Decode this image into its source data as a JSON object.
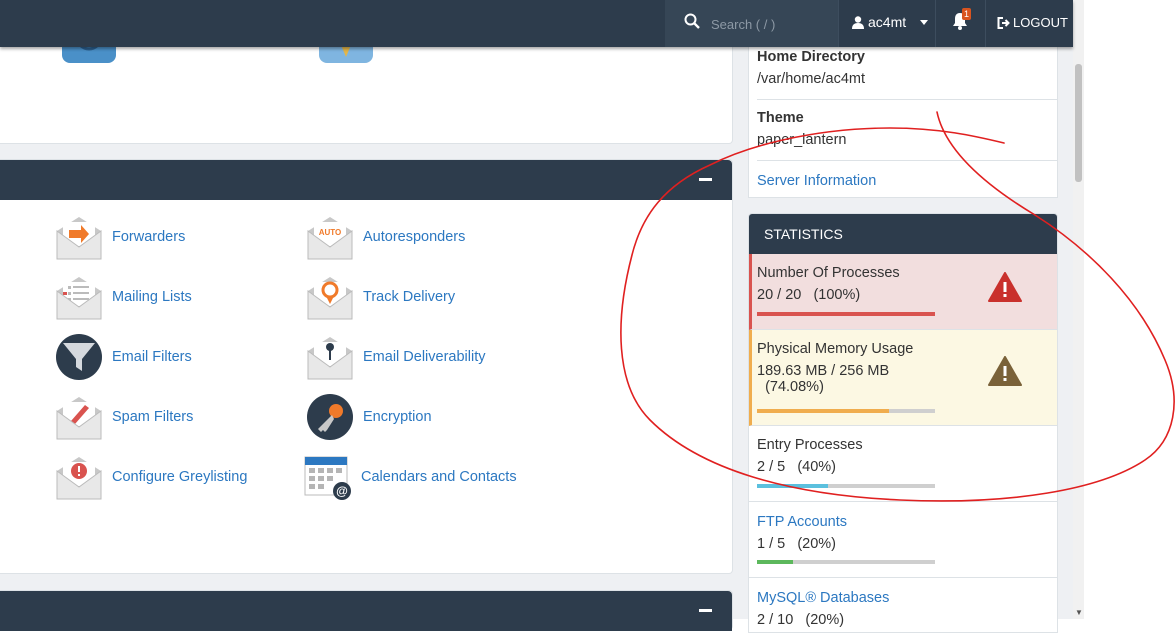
{
  "topbar": {
    "search_placeholder": "Search ( / )",
    "username": "ac4mt",
    "notification_count": "1",
    "logout_label": "LOGOUT"
  },
  "email_section": {
    "left_items": [
      {
        "label": "Forwarders",
        "icon": "forwarders-icon"
      },
      {
        "label": "Mailing Lists",
        "icon": "mailing-lists-icon"
      },
      {
        "label": "Email Filters",
        "icon": "email-filters-icon"
      },
      {
        "label": "Spam Filters",
        "icon": "spam-filters-icon"
      },
      {
        "label": "Configure Greylisting",
        "icon": "greylisting-icon"
      }
    ],
    "right_items": [
      {
        "label": "Autoresponders",
        "icon": "autoresponders-icon",
        "icon_text": "AUTO"
      },
      {
        "label": "Track Delivery",
        "icon": "track-delivery-icon"
      },
      {
        "label": "Email Deliverability",
        "icon": "email-deliverability-icon"
      },
      {
        "label": "Encryption",
        "icon": "encryption-icon"
      },
      {
        "label": "Calendars and Contacts",
        "icon": "calendars-contacts-icon"
      }
    ]
  },
  "general_info": {
    "home_directory_label": "Home Directory",
    "home_directory_value": "/var/home/ac4mt",
    "theme_label": "Theme",
    "theme_value": "paper_lantern",
    "server_info_link": "Server Information"
  },
  "statistics": {
    "title": "STATISTICS",
    "items": [
      {
        "name": "Number Of Processes",
        "usage": "20 / 20",
        "percent": "(100%)",
        "fraction": 1.0,
        "color": "#d9534f",
        "status": "danger"
      },
      {
        "name": "Physical Memory Usage",
        "usage": "189.63 MB / 256 MB",
        "percent": "(74.08%)",
        "fraction": 0.7408,
        "color": "#f0ad4e",
        "status": "warning"
      },
      {
        "name": "Entry Processes",
        "usage": "2 / 5",
        "percent": "(40%)",
        "fraction": 0.4,
        "color": "#5bc0de",
        "status": "normal"
      },
      {
        "name": "FTP Accounts",
        "usage": "1 / 5",
        "percent": "(20%)",
        "fraction": 0.2,
        "color": "#5cb85c",
        "status": "link"
      },
      {
        "name": "MySQL® Databases",
        "usage": "2 / 10",
        "percent": "(20%)",
        "fraction": 0.2,
        "color": "#5cb85c",
        "status": "link"
      }
    ]
  },
  "colors": {
    "nav": "#2d3c4c",
    "link": "#2c78c1",
    "danger_bg": "#f2dede",
    "warning_bg": "#fcf8e3",
    "annotation": "#e02020"
  }
}
